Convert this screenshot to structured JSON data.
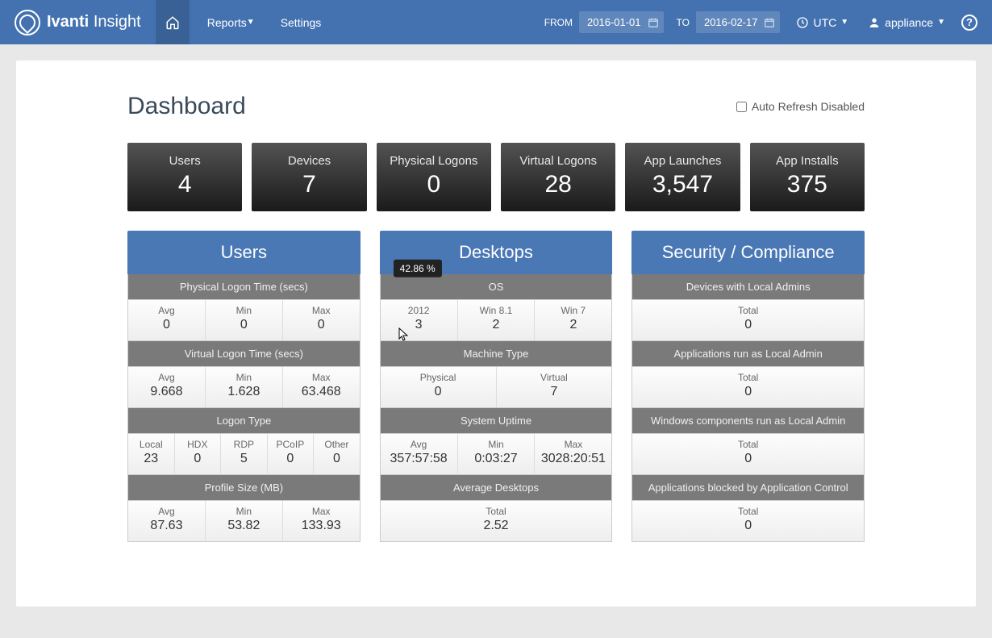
{
  "brand": {
    "bold": "Ivanti",
    "light": "Insight"
  },
  "nav": {
    "reports": "Reports",
    "settings": "Settings"
  },
  "dates": {
    "from_label": "FROM",
    "from": "2016-01-01",
    "to_label": "TO",
    "to": "2016-02-17"
  },
  "tz": {
    "label": "UTC"
  },
  "user": {
    "label": "appliance"
  },
  "page": {
    "title": "Dashboard",
    "auto_refresh": "Auto Refresh Disabled"
  },
  "tiles": {
    "users": {
      "label": "Users",
      "value": "4"
    },
    "devices": {
      "label": "Devices",
      "value": "7"
    },
    "physical_logons": {
      "label": "Physical Logons",
      "value": "0"
    },
    "virtual_logons": {
      "label": "Virtual Logons",
      "value": "28"
    },
    "app_launches": {
      "label": "App Launches",
      "value": "3,547"
    },
    "app_installs": {
      "label": "App Installs",
      "value": "375"
    }
  },
  "users_col": {
    "header": "Users",
    "phys_logon": {
      "title": "Physical Logon Time (secs)",
      "avg_l": "Avg",
      "avg": "0",
      "min_l": "Min",
      "min": "0",
      "max_l": "Max",
      "max": "0"
    },
    "virt_logon": {
      "title": "Virtual Logon Time (secs)",
      "avg_l": "Avg",
      "avg": "9.668",
      "min_l": "Min",
      "min": "1.628",
      "max_l": "Max",
      "max": "63.468"
    },
    "logon_type": {
      "title": "Logon Type",
      "local_l": "Local",
      "local": "23",
      "hdx_l": "HDX",
      "hdx": "0",
      "rdp_l": "RDP",
      "rdp": "5",
      "pcoip_l": "PCoIP",
      "pcoip": "0",
      "other_l": "Other",
      "other": "0"
    },
    "profile": {
      "title": "Profile Size (MB)",
      "avg_l": "Avg",
      "avg": "87.63",
      "min_l": "Min",
      "min": "53.82",
      "max_l": "Max",
      "max": "133.93"
    }
  },
  "desktops_col": {
    "header": "Desktops",
    "os": {
      "title": "OS",
      "tooltip": "42.86 %",
      "c1_l": "2012",
      "c1": "3",
      "c2_l": "Win 8.1",
      "c2": "2",
      "c3_l": "Win 7",
      "c3": "2"
    },
    "machine": {
      "title": "Machine Type",
      "phys_l": "Physical",
      "phys": "0",
      "virt_l": "Virtual",
      "virt": "7"
    },
    "uptime": {
      "title": "System Uptime",
      "avg_l": "Avg",
      "avg": "357:57:58",
      "min_l": "Min",
      "min": "0:03:27",
      "max_l": "Max",
      "max": "3028:20:51"
    },
    "avg_desk": {
      "title": "Average Desktops",
      "total_l": "Total",
      "total": "2.52"
    }
  },
  "sec_col": {
    "header": "Security / Compliance",
    "local_admins": {
      "title": "Devices with Local Admins",
      "total_l": "Total",
      "total": "0"
    },
    "apps_admin": {
      "title": "Applications run as Local Admin",
      "total_l": "Total",
      "total": "0"
    },
    "win_admin": {
      "title": "Windows components run as Local Admin",
      "total_l": "Total",
      "total": "0"
    },
    "blocked": {
      "title": "Applications blocked by Application Control",
      "total_l": "Total",
      "total": "0"
    }
  }
}
